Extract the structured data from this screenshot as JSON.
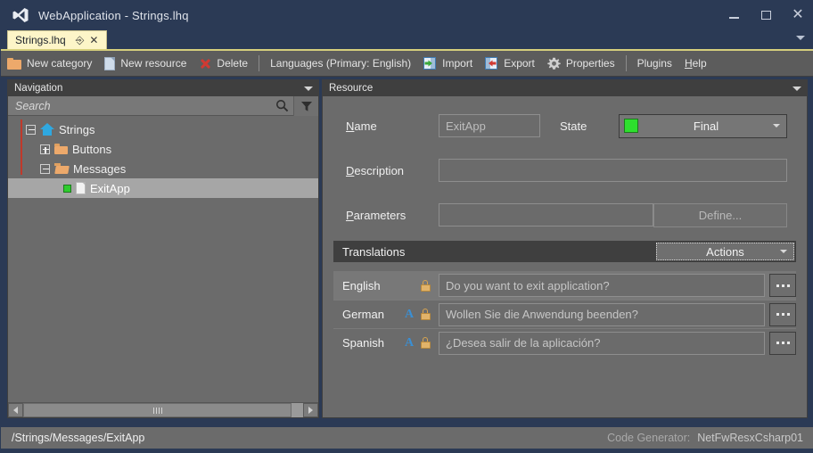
{
  "window": {
    "title": "WebApplication - Strings.lhq",
    "logo_icon": "visual-studio-logo-icon",
    "controls": {
      "minimize": "minimize-icon",
      "maximize": "maximize-icon",
      "close": "close-icon"
    }
  },
  "tabs": {
    "active": "Strings.lhq",
    "pin_icon": "pin-icon",
    "close_icon": "close-icon",
    "overflow_icon": "chevron-down-icon"
  },
  "toolbar": {
    "items": [
      {
        "label": "New category",
        "icon": "folder-icon"
      },
      {
        "label": "New resource",
        "icon": "document-icon"
      },
      {
        "label": "Delete",
        "icon": "red-x-icon"
      },
      {
        "label": "Languages (Primary: English)",
        "icon": ""
      },
      {
        "label": "Import",
        "icon": "import-icon"
      },
      {
        "label": "Export",
        "icon": "export-icon"
      },
      {
        "label": "Properties",
        "icon": "gear-icon"
      },
      {
        "label": "Plugins",
        "icon": ""
      },
      {
        "label": "Help",
        "icon": ""
      }
    ]
  },
  "navigation": {
    "header": "Navigation",
    "collapse_icon": "chevron-down-icon",
    "search": {
      "placeholder": "Search",
      "value": "",
      "search_icon": "search-icon",
      "filter_icon": "filter-icon"
    },
    "tree": [
      {
        "label": "Strings",
        "icon": "home-icon",
        "expander": "minus",
        "depth": 0,
        "selected": false
      },
      {
        "label": "Buttons",
        "icon": "folder-icon",
        "expander": "plus",
        "depth": 1,
        "selected": false
      },
      {
        "label": "Messages",
        "icon": "folder-open-icon",
        "expander": "minus",
        "depth": 1,
        "selected": false
      },
      {
        "label": "ExitApp",
        "icon": "document-icon",
        "expander": "none",
        "depth": 2,
        "selected": true,
        "status": "final"
      }
    ],
    "scrollbar": {
      "left_icon": "arrow-left-icon",
      "right_icon": "arrow-right-icon",
      "grip_icon": "grip-icon"
    }
  },
  "resource": {
    "header": "Resource",
    "collapse_icon": "chevron-down-icon",
    "fields": {
      "name_label": "Name",
      "name_value": "ExitApp",
      "state_label": "State",
      "state_value": "Final",
      "state_color": "#2ee02e",
      "description_label": "Description",
      "description_value": "",
      "parameters_label": "Parameters",
      "parameters_value": "",
      "define_label": "Define..."
    },
    "translations": {
      "title": "Translations",
      "actions_label": "Actions",
      "rows": [
        {
          "language": "English",
          "text": "Do you want to exit application?",
          "auto_icon": false,
          "lock_icon": true,
          "more_icon": "ellipsis-icon",
          "highlight": true
        },
        {
          "language": "German",
          "text": "Wollen Sie die Anwendung beenden?",
          "auto_icon": true,
          "lock_icon": true,
          "more_icon": "ellipsis-icon",
          "highlight": false
        },
        {
          "language": "Spanish",
          "text": "¿Desea salir de la aplicación?",
          "auto_icon": true,
          "lock_icon": true,
          "more_icon": "ellipsis-icon",
          "highlight": false
        }
      ]
    }
  },
  "statusbar": {
    "path": "/Strings/Messages/ExitApp",
    "codegen_label": "Code Generator:",
    "codegen_value": "NetFwResxCsharp01"
  },
  "colors": {
    "window_chrome": "#2b3a55",
    "panel_bg": "#6b6b6b",
    "toolbar_bg": "#5c5c5c",
    "header_bg": "#3f3f3f",
    "tab_active": "#fdf5c8",
    "accent_green": "#2ee02e",
    "accent_orange": "#eda96b",
    "accent_blue": "#2fa8e0",
    "accent_red": "#d03a33"
  }
}
